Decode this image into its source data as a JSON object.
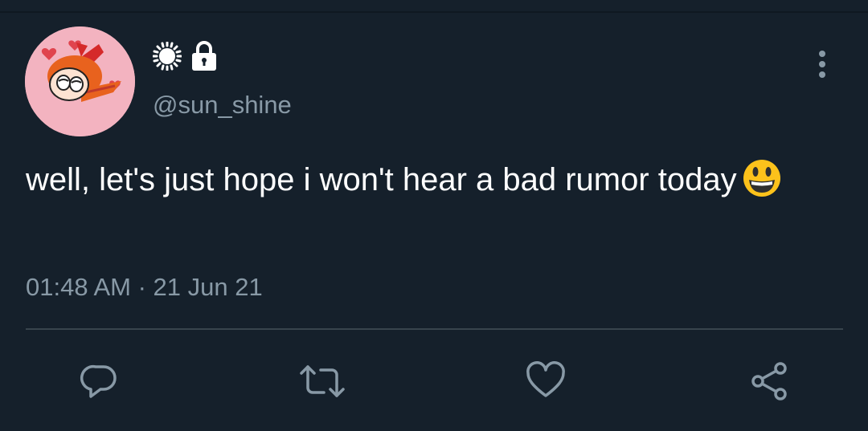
{
  "tweet": {
    "display_name_icons": [
      "sun-icon",
      "lock-icon"
    ],
    "handle": "@sun_shine",
    "text": "well, let's just hope i won't hear a bad rumor today",
    "emoji": "grinning-face-icon",
    "timestamp": "01:48 AM · 21 Jun 21"
  },
  "actions": [
    "reply-icon",
    "retweet-icon",
    "like-icon",
    "share-icon"
  ],
  "colors": {
    "background": "#15202b",
    "secondary_text": "#8899a6",
    "divider": "#38444d",
    "avatar_bg": "#f3b3c0"
  }
}
